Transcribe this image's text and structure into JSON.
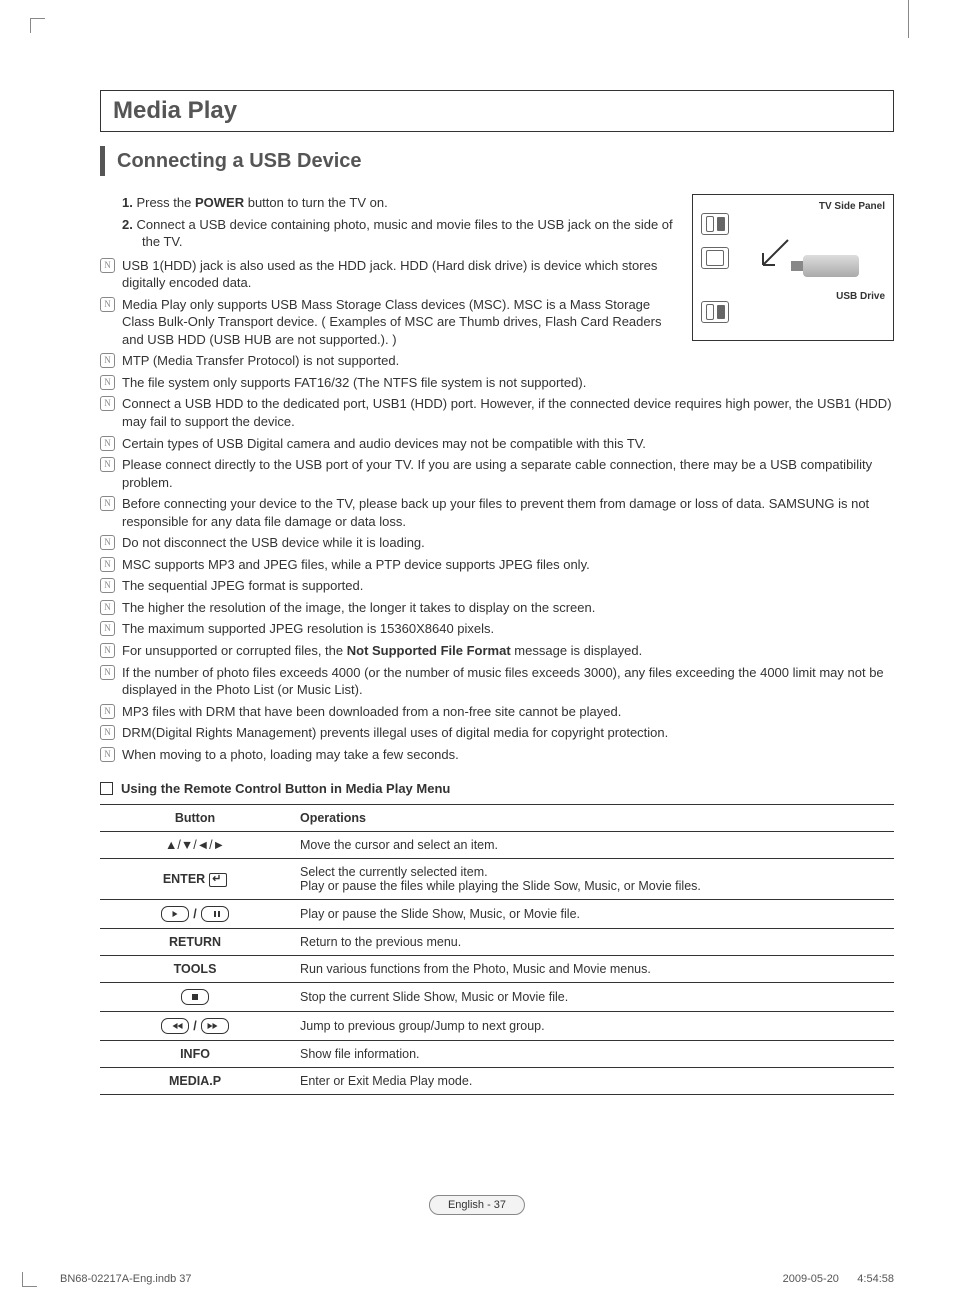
{
  "main_title": "Media Play",
  "section_title": "Connecting a USB Device",
  "diagram": {
    "panel_label": "TV Side Panel",
    "drive_label": "USB Drive"
  },
  "steps": [
    {
      "pre": "Press the ",
      "bold": "POWER",
      "post": " button to turn the TV on."
    },
    {
      "pre": "Connect a USB device containing photo, music and movie files to the USB jack on the side of the TV.",
      "bold": "",
      "post": ""
    }
  ],
  "notes_narrow": [
    "USB 1(HDD) jack is also used as the HDD jack. HDD (Hard disk drive) is device which stores digitally encoded data.",
    "Media Play only supports USB Mass Storage Class devices (MSC). MSC is a Mass Storage Class Bulk-Only Transport device. ( Examples of MSC are Thumb drives, Flash Card Readers and USB HDD (USB HUB are not supported.). )",
    "MTP (Media Transfer Protocol) is not supported.",
    "The file system only supports FAT16/32 (The NTFS file system is not supported)."
  ],
  "notes_full": [
    "Connect a USB HDD to the dedicated port, USB1 (HDD) port. However, if the connected device requires high power, the USB1 (HDD) may fail to support the device.",
    "Certain types of USB Digital camera and audio devices may not be compatible with this TV.",
    "Please connect directly to the USB port of your TV. If you are using a separate cable connection, there may be a USB compatibility problem.",
    "Before connecting your device to the TV, please back up your files to prevent them from damage or loss of data. SAMSUNG is not responsible for any data file damage or data loss.",
    "Do not disconnect the USB device while it is loading.",
    "MSC supports MP3 and JPEG files, while a PTP device supports JPEG files only.",
    "The sequential JPEG format is supported.",
    "The higher the resolution of the image, the longer it takes to display on the screen.",
    "The maximum supported JPEG resolution is 15360X8640 pixels.",
    {
      "pre": "For unsupported or corrupted files, the ",
      "bold": "Not Supported File Format",
      "post": " message is displayed."
    },
    "If the number of photo files exceeds 4000 (or the number of music files exceeds 3000), any files exceeding the 4000 limit may not be displayed in the Photo List (or Music List).",
    "MP3 files with DRM that have been downloaded from a non-free site cannot be played.",
    "DRM(Digital Rights Management) prevents illegal uses of digital media for copyright protection.",
    "When moving to a photo, loading may take a few seconds."
  ],
  "sub_heading": "Using the Remote Control Button in Media Play Menu",
  "table": {
    "headers": [
      "Button",
      "Operations"
    ],
    "rows": [
      {
        "btn_type": "arrows",
        "op": "Move the cursor and select an item."
      },
      {
        "btn_type": "enter",
        "label": "ENTER",
        "op": "Select the currently selected item.\nPlay or pause the files while playing the Slide Sow, Music, or Movie files."
      },
      {
        "btn_type": "playpause",
        "op": "Play or pause the Slide Show, Music, or Movie file."
      },
      {
        "btn_type": "text",
        "label": "RETURN",
        "op": "Return to the previous menu."
      },
      {
        "btn_type": "text",
        "label": "TOOLS",
        "op": "Run various functions from the Photo, Music and Movie menus."
      },
      {
        "btn_type": "stop",
        "op": "Stop the current Slide Show, Music or Movie file."
      },
      {
        "btn_type": "prevnext",
        "op": "Jump to previous group/Jump to next group."
      },
      {
        "btn_type": "text",
        "label": "INFO",
        "op": "Show file information."
      },
      {
        "btn_type": "text",
        "label": "MEDIA.P",
        "op": "Enter or Exit Media Play mode."
      }
    ]
  },
  "footer_pill": "English - 37",
  "print_footer": {
    "left": "BN68-02217A-Eng.indb   37",
    "right_date": "2009-05-20",
    "right_time": "   4:54:58"
  }
}
